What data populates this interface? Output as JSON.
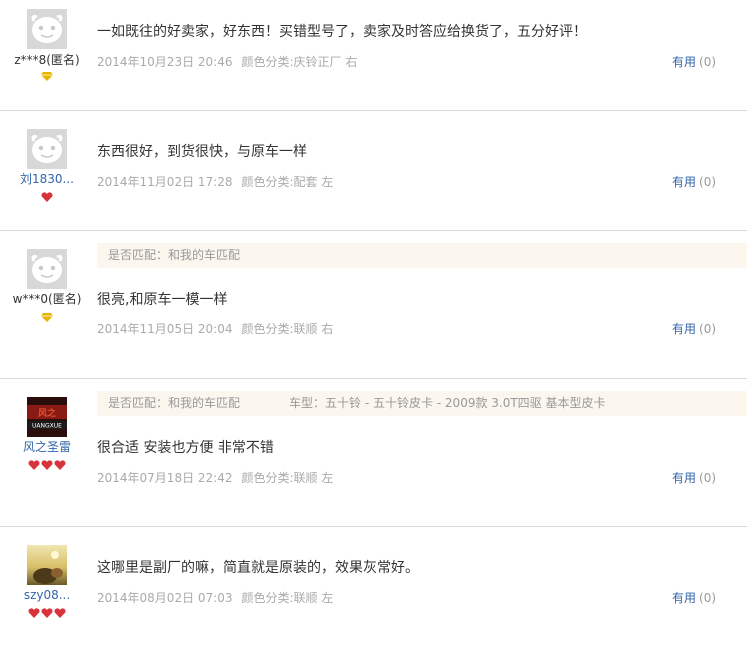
{
  "labels": {
    "helpful": "有用",
    "match_prefix": "是否匹配：",
    "car_prefix": "车型："
  },
  "colors": {
    "link_blue": "#3366aa",
    "meta_gray": "#aaaaaa",
    "match_bg": "#fbf6ee",
    "divider": "#d9d9d9",
    "badge_gold": "#e8b400",
    "badge_red": "#d8323b"
  },
  "reviews": [
    {
      "username": "z***8(匿名)",
      "avatar": "default-avatar-icon",
      "badge": "gold-diamond-icon",
      "badge_count": 1,
      "comment": "一如既往的好卖家，好东西！买错型号了，卖家及时答应给换货了，五分好评！",
      "date": "2014年10月23日 20:46",
      "sku": "颜色分类:庆铃正厂 右",
      "helpful_count": "(0)"
    },
    {
      "username": "刘1830...",
      "avatar": "default-avatar-icon",
      "badge": "red-heart-icon",
      "badge_count": 1,
      "comment": "东西很好，到货很快，与原车一样",
      "date": "2014年11月02日 17:28",
      "sku": "颜色分类:配套 左",
      "helpful_count": "(0)"
    },
    {
      "username": "w***0(匿名)",
      "avatar": "default-avatar-icon",
      "badge": "gold-diamond-icon",
      "badge_count": 1,
      "match": "是否匹配：和我的车匹配",
      "comment": "很亮,和原车一模一样",
      "date": "2014年11月05日 20:04",
      "sku": "颜色分类:联顺 右",
      "helpful_count": "(0)"
    },
    {
      "username": "风之圣雷",
      "avatar": "custom-avatar-dark-red",
      "avatar_text": "UANGXUE",
      "badge": "red-heart-icon",
      "badge_count": 3,
      "match": "是否匹配：和我的车匹配",
      "car_model": "车型：五十铃 - 五十铃皮卡 - 2009款 3.0T四驱 基本型皮卡",
      "comment": "很合适 安装也方便 非常不错",
      "date": "2014年07月18日 22:42",
      "sku": "颜色分类:联顺 左",
      "helpful_count": "(0)"
    },
    {
      "username": "szy08...",
      "avatar": "custom-avatar-photo",
      "badge": "red-heart-icon",
      "badge_count": 3,
      "comment": "这哪里是副厂的嘛，简直就是原装的，效果灰常好。",
      "date": "2014年08月02日 07:03",
      "sku": "颜色分类:联顺 左",
      "helpful_count": "(0)"
    }
  ]
}
